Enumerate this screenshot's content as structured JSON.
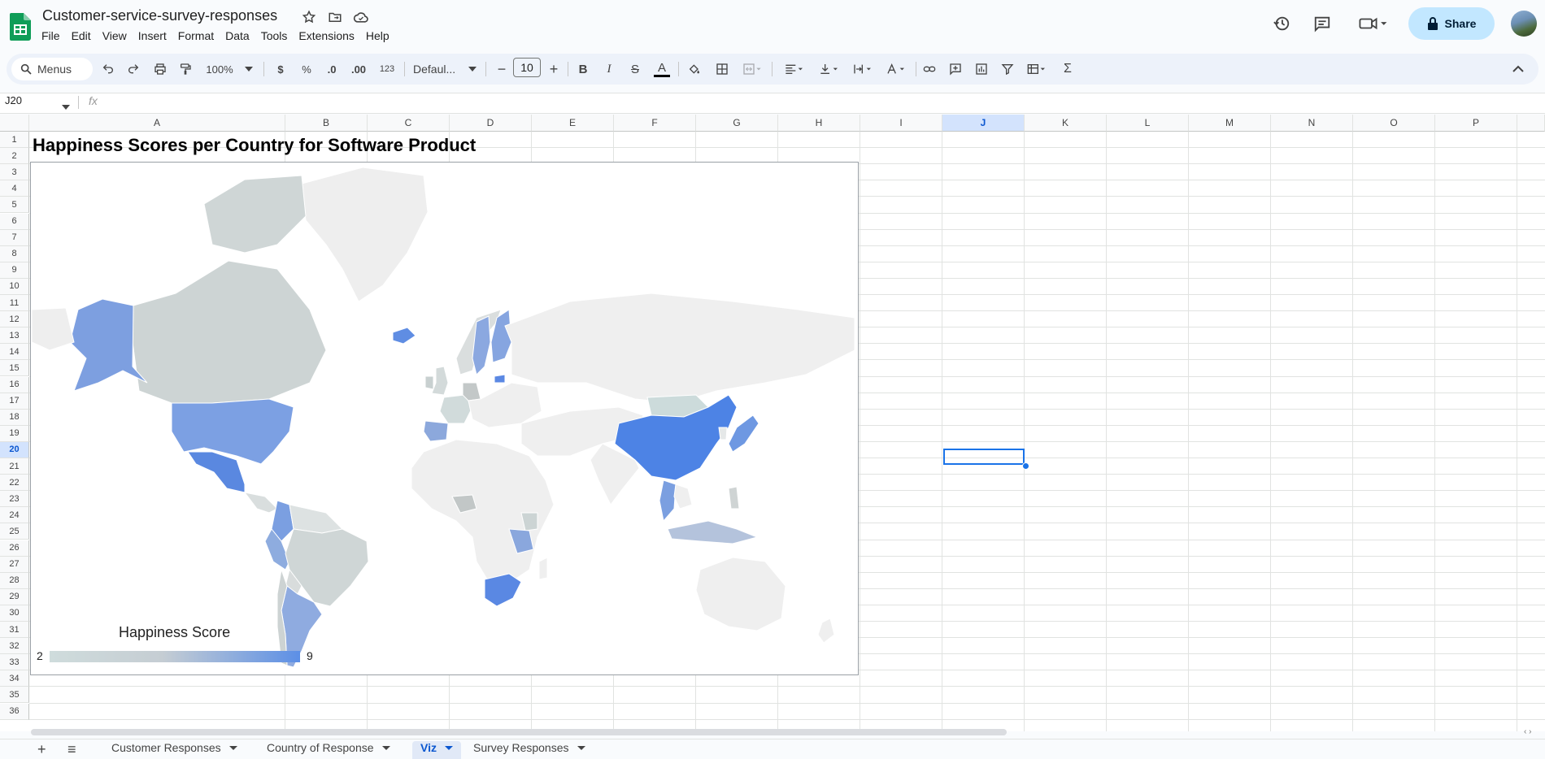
{
  "app": {
    "doc_title": "Customer-service-survey-responses",
    "menu": [
      "File",
      "Edit",
      "View",
      "Insert",
      "Format",
      "Data",
      "Tools",
      "Extensions",
      "Help"
    ],
    "share_label": "Share"
  },
  "toolbar": {
    "search_placeholder": "Menus",
    "zoom": "100%",
    "currency": "$",
    "percent": "%",
    "dec_decrease": ".0",
    "dec_increase": ".00",
    "number_format": "123",
    "font_family": "Defaul...",
    "font_size": "10",
    "minus": "−",
    "plus": "+",
    "bold": "B",
    "italic": "I",
    "strike": "S",
    "text_color": "A",
    "sum": "Σ"
  },
  "formula_bar": {
    "name_box": "J20",
    "fx": "fx",
    "value": ""
  },
  "grid": {
    "columns": [
      "A",
      "B",
      "C",
      "D",
      "E",
      "F",
      "G",
      "H",
      "I",
      "J",
      "K",
      "L",
      "M",
      "N",
      "O",
      "P"
    ],
    "selected_column": "J",
    "selected_row": "20",
    "rows": [
      "1",
      "2",
      "3",
      "4",
      "5",
      "6",
      "7",
      "8",
      "9",
      "10",
      "11",
      "12",
      "13",
      "14",
      "15",
      "16",
      "17",
      "18",
      "19",
      "20",
      "21",
      "22",
      "23",
      "24",
      "25",
      "26",
      "27",
      "28",
      "29",
      "30",
      "31",
      "32",
      "33",
      "34",
      "35",
      "36"
    ],
    "cell_A1": "Happiness Scores per Country for Software Product"
  },
  "chart_data": {
    "type": "geo",
    "title": "Happiness Scores per Country for Software Product",
    "legend_title": "Happiness Score",
    "color_axis": {
      "min": 2,
      "max": 9,
      "min_color": "#cfdcdc",
      "max_color": "#5c8fe6"
    },
    "highlighted_regions": [
      "United States",
      "Mexico",
      "Canada",
      "Colombia",
      "Peru",
      "Argentina",
      "Brazil",
      "United Kingdom",
      "Ireland",
      "France",
      "Portugal",
      "Spain",
      "Sweden",
      "Finland",
      "Norway",
      "Iceland",
      "China",
      "Mongolia",
      "Japan",
      "Thailand",
      "Indonesia",
      "South Africa",
      "Kenya",
      "Tanzania",
      "Angola"
    ]
  },
  "legend": {
    "min_label": "2",
    "max_label": "9",
    "title": "Happiness Score"
  },
  "sheets": {
    "add": "+",
    "list": "≡",
    "tabs": [
      "Customer Responses",
      "Country of Response",
      "Viz",
      "Survey Responses"
    ],
    "active_tab": "Viz"
  },
  "colors": {
    "accent": "#1a73e8",
    "share_bg": "#c2e7ff",
    "sheets_green": "#0f9d58"
  }
}
